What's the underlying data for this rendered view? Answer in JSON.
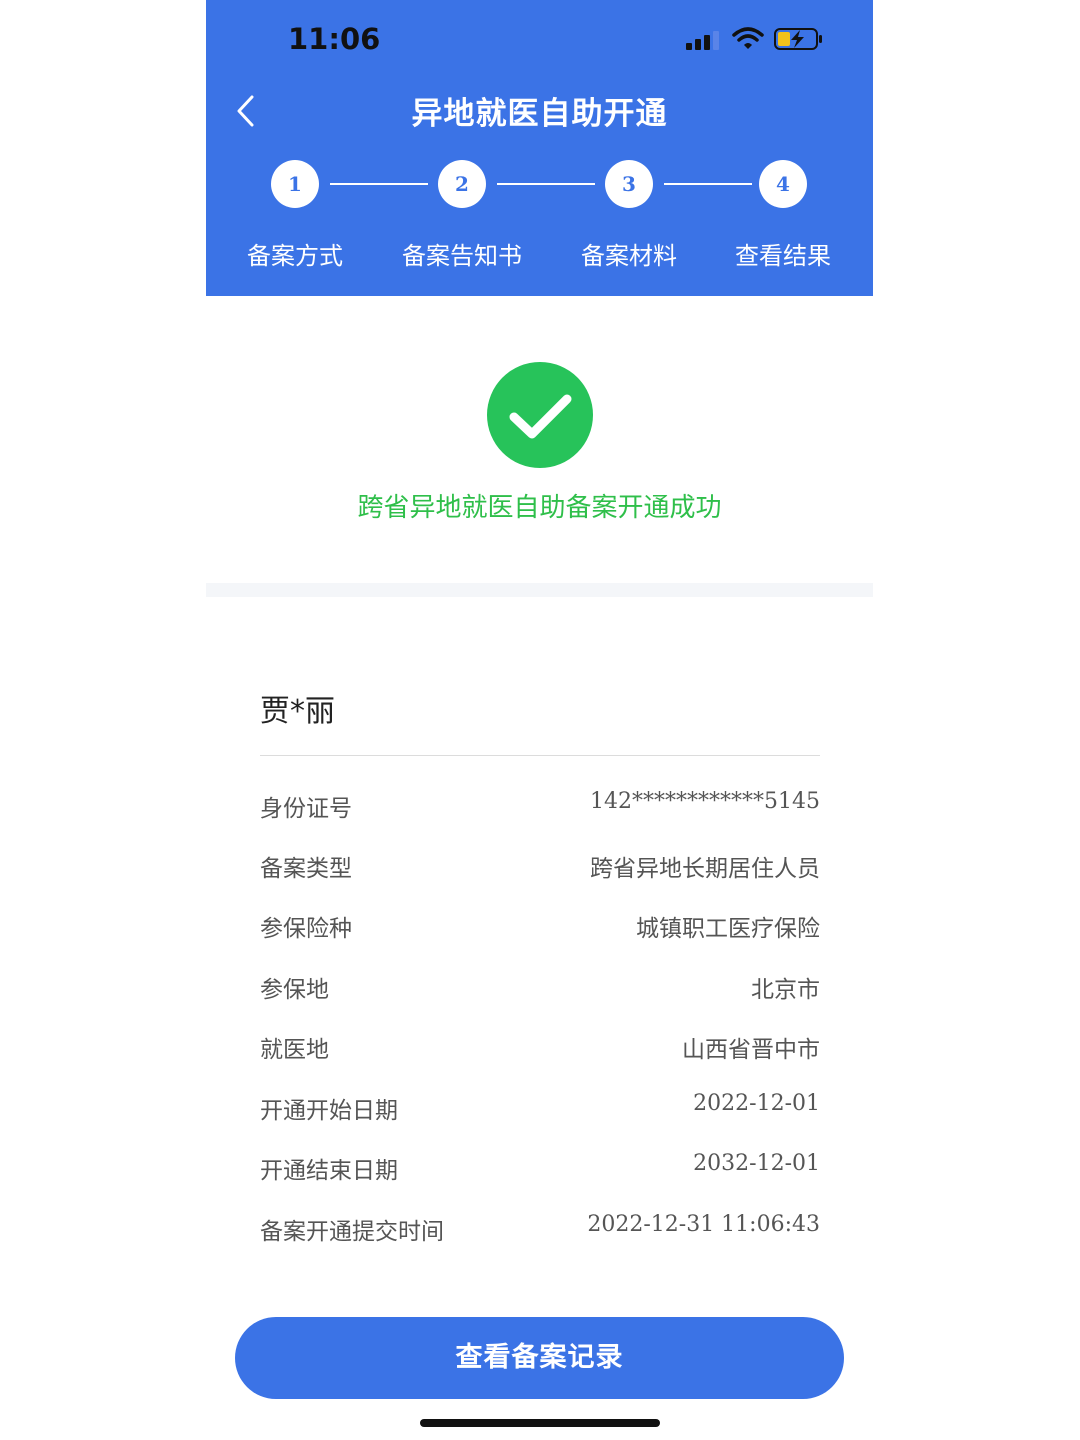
{
  "status_bar": {
    "time": "11:06"
  },
  "nav": {
    "title": "异地就医自助开通"
  },
  "steps": [
    {
      "number": "1",
      "label": "备案方式"
    },
    {
      "number": "2",
      "label": "备案告知书"
    },
    {
      "number": "3",
      "label": "备案材料"
    },
    {
      "number": "4",
      "label": "查看结果"
    }
  ],
  "result": {
    "message": "跨省异地就医自助备案开通成功"
  },
  "person": {
    "name": "贾*丽"
  },
  "details": [
    {
      "label": "身份证号",
      "value": "142************5145"
    },
    {
      "label": "备案类型",
      "value": "跨省异地长期居住人员"
    },
    {
      "label": "参保险种",
      "value": "城镇职工医疗保险"
    },
    {
      "label": "参保地",
      "value": "北京市"
    },
    {
      "label": "就医地",
      "value": "山西省晋中市"
    },
    {
      "label": "开通开始日期",
      "value": "2022-12-01"
    },
    {
      "label": "开通结束日期",
      "value": "2032-12-01"
    },
    {
      "label": "备案开通提交时间",
      "value": "2022-12-31 11:06:43"
    }
  ],
  "actions": {
    "view_records": "查看备案记录"
  },
  "colors": {
    "primary": "#3b73e6",
    "success": "#2fbf4a",
    "success_icon": "#27c35a"
  }
}
